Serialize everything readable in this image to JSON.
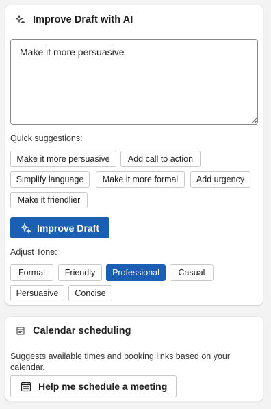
{
  "ai_panel": {
    "title": "Improve Draft with AI",
    "icon": "sparkle-icon",
    "prompt_value": "Make it more persuasive",
    "quick_suggestions_label": "Quick suggestions:",
    "suggestions": [
      "Make it more persuasive",
      "Add call to action",
      "Simplify language",
      "Make it more formal",
      "Add urgency",
      "Make it friendlier"
    ],
    "improve_button_label": "Improve Draft",
    "adjust_tone_label": "Adjust Tone:",
    "tones": [
      "Formal",
      "Friendly",
      "Professional",
      "Casual",
      "Persuasive",
      "Concise"
    ],
    "selected_tone": "Professional"
  },
  "calendar_panel": {
    "title": "Calendar scheduling",
    "icon": "calendar-icon",
    "description": "Suggests available times and booking links based on your calendar.",
    "button_label": "Help me schedule a meeting"
  },
  "colors": {
    "accent": "#1a5fb4",
    "background": "#f3f3f3",
    "card": "#ffffff",
    "chip_border": "#c8c8c8"
  }
}
